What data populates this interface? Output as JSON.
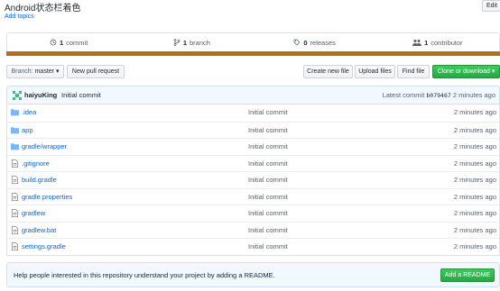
{
  "repo": {
    "title": "Android状态栏着色",
    "add_topics": "Add topics",
    "edit_label": "Edit"
  },
  "summary": {
    "commits": {
      "count": "1",
      "label": "commit",
      "icon": "history-icon"
    },
    "branches": {
      "count": "1",
      "label": "branch",
      "icon": "branch-icon"
    },
    "releases": {
      "count": "0",
      "label": "releases",
      "icon": "tag-icon"
    },
    "contributors": {
      "count": "1",
      "label": "contributor",
      "icon": "people-icon"
    },
    "language_color": "#b07219"
  },
  "toolbar": {
    "branch_prefix": "Branch:",
    "branch_name": "master",
    "new_pr": "New pull request",
    "create_file": "Create new file",
    "upload_files": "Upload files",
    "find_file": "Find file",
    "clone_download": "Clone or download"
  },
  "latest_commit": {
    "author": "haiyuKing",
    "message": "Initial commit",
    "prefix": "Latest commit",
    "sha": "b079467",
    "age": "2 minutes ago"
  },
  "files": [
    {
      "name": ".idea",
      "type": "folder",
      "message": "Initial commit",
      "age": "2 minutes ago"
    },
    {
      "name": "app",
      "type": "folder",
      "message": "Initial commit",
      "age": "2 minutes ago"
    },
    {
      "name": "gradle/wrapper",
      "type": "folder",
      "message": "Initial commit",
      "age": "2 minutes ago"
    },
    {
      "name": ".gitignore",
      "type": "file",
      "message": "Initial commit",
      "age": "2 minutes ago"
    },
    {
      "name": "build.gradle",
      "type": "file",
      "message": "Initial commit",
      "age": "2 minutes ago"
    },
    {
      "name": "gradle.properties",
      "type": "file",
      "message": "Initial commit",
      "age": "2 minutes ago"
    },
    {
      "name": "gradlew",
      "type": "file",
      "message": "Initial commit",
      "age": "2 minutes ago"
    },
    {
      "name": "gradlew.bat",
      "type": "file",
      "message": "Initial commit",
      "age": "2 minutes ago"
    },
    {
      "name": "settings.gradle",
      "type": "file",
      "message": "Initial commit",
      "age": "2 minutes ago"
    }
  ],
  "readme_prompt": {
    "text": "Help people interested in this repository understand your project by adding a README.",
    "button": "Add a README"
  }
}
